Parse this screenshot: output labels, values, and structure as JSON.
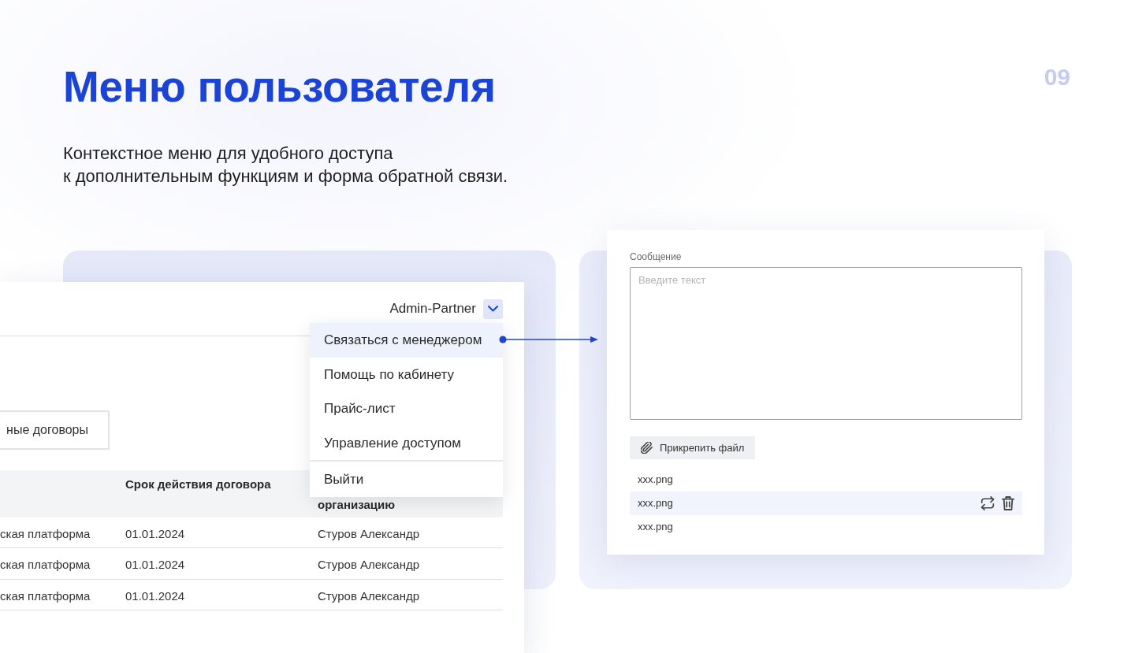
{
  "slide": {
    "title": "Меню пользователя",
    "page_number": "09",
    "subtitle": "Контекстное меню для удобного доступа\nк дополнительным функциям и форма обратной связи."
  },
  "account_screen": {
    "user_name": "Admin-Partner",
    "menu": {
      "expanded": true,
      "sections": [
        {
          "items": [
            {
              "label": "Связаться с менеджером",
              "selected": true
            },
            {
              "label": "Помощь по кабинету",
              "selected": false
            },
            {
              "label": "Прайс-лист",
              "selected": false
            },
            {
              "label": "Управление доступом",
              "selected": false
            }
          ]
        },
        {
          "items": [
            {
              "label": "Выйти",
              "selected": false
            }
          ]
        }
      ]
    },
    "tab": {
      "label": "ные договоры"
    },
    "table": {
      "columns": [
        null,
        "Срок действия договора",
        "организацию"
      ],
      "rows": [
        [
          "ская платформа",
          "01.01.2024",
          "Стуров Александр"
        ],
        [
          "ская платформа",
          "01.01.2024",
          "Стуров Александр"
        ],
        [
          "ская платформа",
          "01.01.2024",
          "Стуров Александр"
        ]
      ]
    }
  },
  "feedback_form": {
    "message": {
      "label": "Сообщение",
      "placeholder": "Введите текст"
    },
    "attach_button": "Прикрепить файл",
    "files": [
      {
        "name": "xxx.png",
        "selected": false
      },
      {
        "name": "xxx.png",
        "selected": true
      },
      {
        "name": "xxx.png",
        "selected": false
      }
    ]
  }
}
